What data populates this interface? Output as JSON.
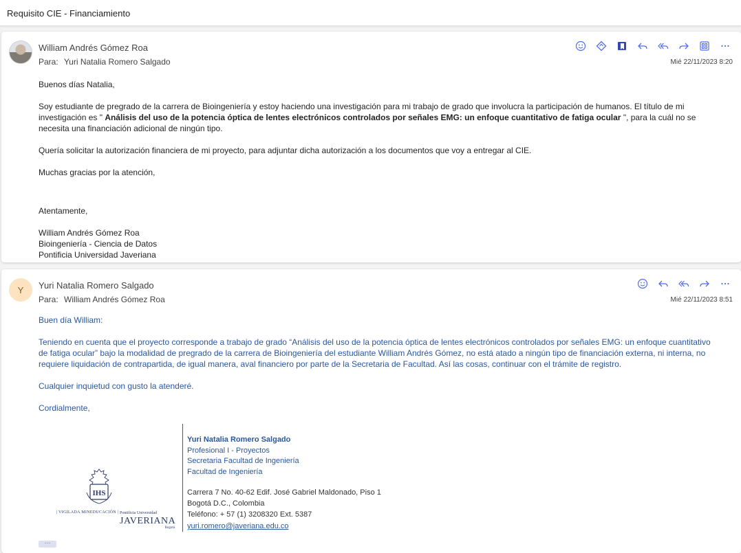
{
  "subject": "Requisito CIE - Financiamiento",
  "colors": {
    "accent": "#4f6bed",
    "body_blue": "#2b579a",
    "avatar_y": "#fde3c0"
  },
  "messages": [
    {
      "sender": "William Andrés Gómez Roa",
      "to_label": "Para:",
      "to": "Yuri Natalia Romero Salgado",
      "date": "Mié 22/11/2023 8:20",
      "actions": [
        "emoji-icon",
        "loop-icon",
        "bookmark-icon",
        "reply-icon",
        "reply-all-icon",
        "forward-icon",
        "apps-icon",
        "more-icon"
      ],
      "greeting": "Buenos días Natalia,",
      "para1_pre": "Soy estudiante de pregrado de la carrera de Bioingeniería y estoy haciendo una investigación para mi trabajo de grado que involucra la participación de humanos. El título de mi investigación es \" ",
      "para1_bold": "Análisis del uso de la potencia óptica de lentes electrónicos controlados por señales EMG: un enfoque cuantitativo de fatiga ocular",
      "para1_post": " \", para la cuál no se necesita una financiación adicional de ningún tipo.",
      "para2": " Quería solicitar la autorización financiera de mi proyecto, para adjuntar dicha autorización a los documentos que voy a entregar al CIE.",
      "para3": "Muchas gracias por la atención,",
      "closing": "Atentamente,",
      "sig_name": "William Andrés Gómez Roa",
      "sig_program": "Bioingeniería - Ciencia de Datos",
      "sig_university": "Pontificia Universidad Javeriana"
    },
    {
      "sender": "Yuri Natalia Romero Salgado",
      "initial": "Y",
      "to_label": "Para:",
      "to": "William Andrés Gómez Roa",
      "date": "Mié 22/11/2023 8:51",
      "actions": [
        "emoji-icon",
        "reply-icon",
        "reply-all-icon",
        "forward-icon",
        "more-icon"
      ],
      "greeting": "Buen día William:",
      "para1": "Teniendo en cuenta que el proyecto corresponde a trabajo de grado “Análisis del uso de la potencia óptica de lentes electrónicos controlados por señales EMG: un enfoque cuantitativo de fatiga ocular” bajo la modalidad de pregrado de la carrera de Bioingeniería del estudiante William Andrés Gómez, no está atado a ningún tipo de financiación externa, ni interna, no requiere liquidación de contrapartida, de igual manera, aval financiero por parte de la Secretaria de Facultad. Así las cosas, continuar con el trámite de registro.",
      "para2": "Cualquier inquietud con gusto la atenderé.",
      "closing": "Cordialmente,",
      "signature": {
        "logo_line1": "Pontificia Universidad",
        "logo_line2": "JAVERIANA",
        "logo_line3": "Bogotá",
        "logo_monogram": "IHS",
        "vigilada": "| VIGILADA MINEDUCACIÓN |",
        "name": "Yuri Natalia Romero Salgado",
        "title": "Profesional I - Proyectos",
        "dept": "Secretaria Facultad de Ingeniería",
        "faculty": "Facultad de Ingeniería",
        "address": "Carrera 7 No. 40-62 Edif. José Gabriel Maldonado, Piso 1",
        "city": "Bogotá D.C., Colombia",
        "phone": "Teléfono: + 57 (1) 3208320 Ext. 5387",
        "email": "yuri.romero@javeriana.edu.co"
      },
      "show_more": "···"
    }
  ]
}
